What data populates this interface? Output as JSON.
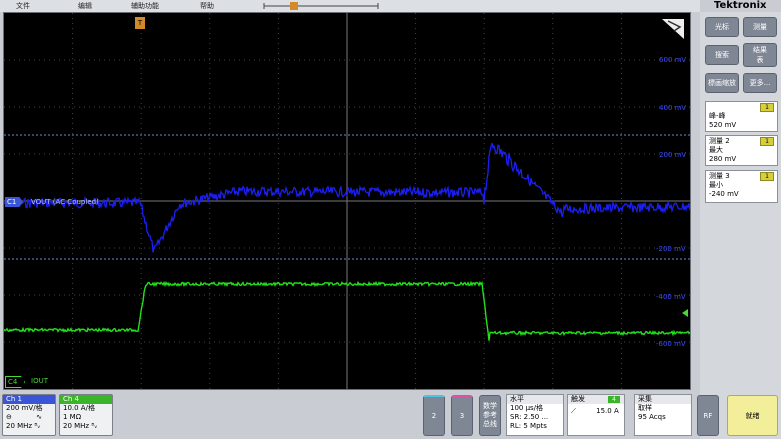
{
  "menu": {
    "file": "文件",
    "edit": "编辑",
    "utility": "辅助功能",
    "help": "帮助"
  },
  "brand": "Tektronix",
  "buttons": {
    "cursor": "光标",
    "measure": "测量",
    "search": "搜索",
    "results_l1": "结果",
    "results_l2": "表",
    "zoom": "缩放",
    "zoom_pre": "標画",
    "more": "更多..."
  },
  "measurements": [
    {
      "title": "",
      "badge": "1",
      "name": "峰-峰",
      "value": "520 mV"
    },
    {
      "title": "测量 2",
      "badge": "1",
      "name": "最大",
      "value": "280 mV"
    },
    {
      "title": "测量 3",
      "badge": "1",
      "name": "最小",
      "value": "-240 mV"
    }
  ],
  "axis_right": [
    "600 mV",
    "400 mV",
    "200 mV",
    "-200 mV",
    "-400 mV",
    "-600 mV"
  ],
  "traces": {
    "c1_marker": "C1",
    "c1_label": "VOUT (AC Coupled)",
    "c4_marker": "C4",
    "c4_label": "IOUT",
    "trigger_marker": "T",
    "c1_color": "#1b1ff0",
    "c4_color": "#22e01a"
  },
  "ch1": {
    "title": "Ch 1",
    "scale": "200 mV/格",
    "bw": "20 MHz",
    "color": "#3a55d6"
  },
  "ch4": {
    "title": "Ch 4",
    "scale": "10.0 A/格",
    "imp": "1 MΩ",
    "bw": "20 MHz",
    "color": "#3ab52a"
  },
  "ch_btn": [
    "2",
    "3"
  ],
  "math": {
    "l1": "数学",
    "l2": "参考",
    "l3": "总线"
  },
  "horizontal": {
    "title": "水平",
    "scale": "100 μs/格",
    "sr": "SR: 2.50 ...",
    "rl": "RL: 5 Mpts"
  },
  "trigger": {
    "title": "触发",
    "ch": "4",
    "level": "15.0 A"
  },
  "acq": {
    "title": "采集",
    "mode": "取样",
    "count": "95 Acqs"
  },
  "rf": "RF",
  "ready": "就绪"
}
